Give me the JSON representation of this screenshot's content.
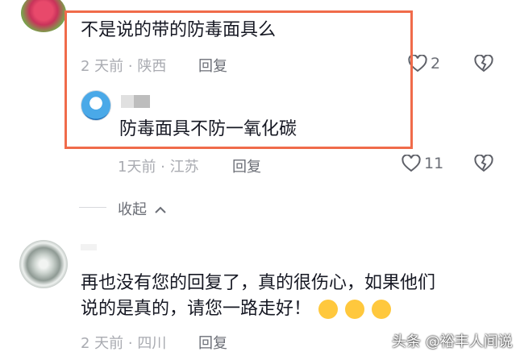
{
  "comments": [
    {
      "text": "不是说的带的防毒面具么",
      "meta": "2 天前 · 陕西",
      "reply_label": "回复",
      "likes": "2"
    },
    {
      "text": "防毒面具不防一氧化碳",
      "meta": "1天前 · 江苏",
      "reply_label": "回复",
      "likes": "11"
    },
    {
      "text_line1": "再也没有您的回复了，真的很伤心，如果他们",
      "text_line2": "说的是真的，请您一路走好！",
      "meta": "2 天前 · 四川",
      "reply_label": "回复"
    }
  ],
  "collapse_label": "收起",
  "watermark": "头条 @裕丰人间说",
  "colors": {
    "highlight": "#f06b4a",
    "meta": "#a9abb1",
    "text": "#161823"
  }
}
